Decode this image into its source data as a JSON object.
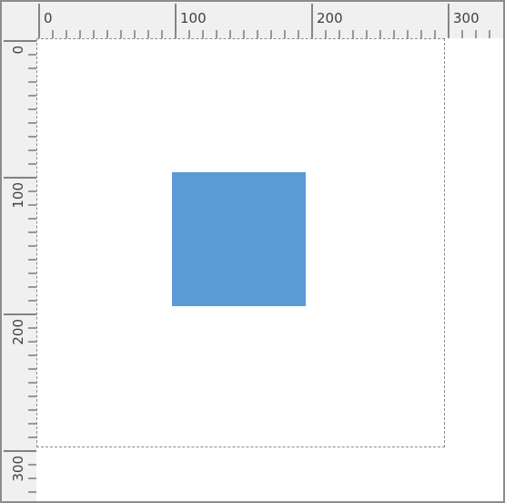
{
  "rulers": {
    "unit_step": 10,
    "major_step": 100,
    "horizontal": {
      "labels": [
        "0",
        "100",
        "200",
        "300"
      ],
      "values": [
        0,
        100,
        200,
        300
      ]
    },
    "vertical": {
      "labels": [
        "0",
        "100",
        "200",
        "300"
      ],
      "values": [
        0,
        100,
        200,
        300
      ]
    }
  },
  "canvas": {
    "artboard_border_style": "dashed",
    "artboard_border_color": "#8a8a8a"
  },
  "shape": {
    "type": "rectangle",
    "fill_color": "#5b9bd5"
  },
  "colors": {
    "ruler_background": "#f0f0f0",
    "ruler_tick": "#404040",
    "window_border": "#8c8c8c"
  }
}
